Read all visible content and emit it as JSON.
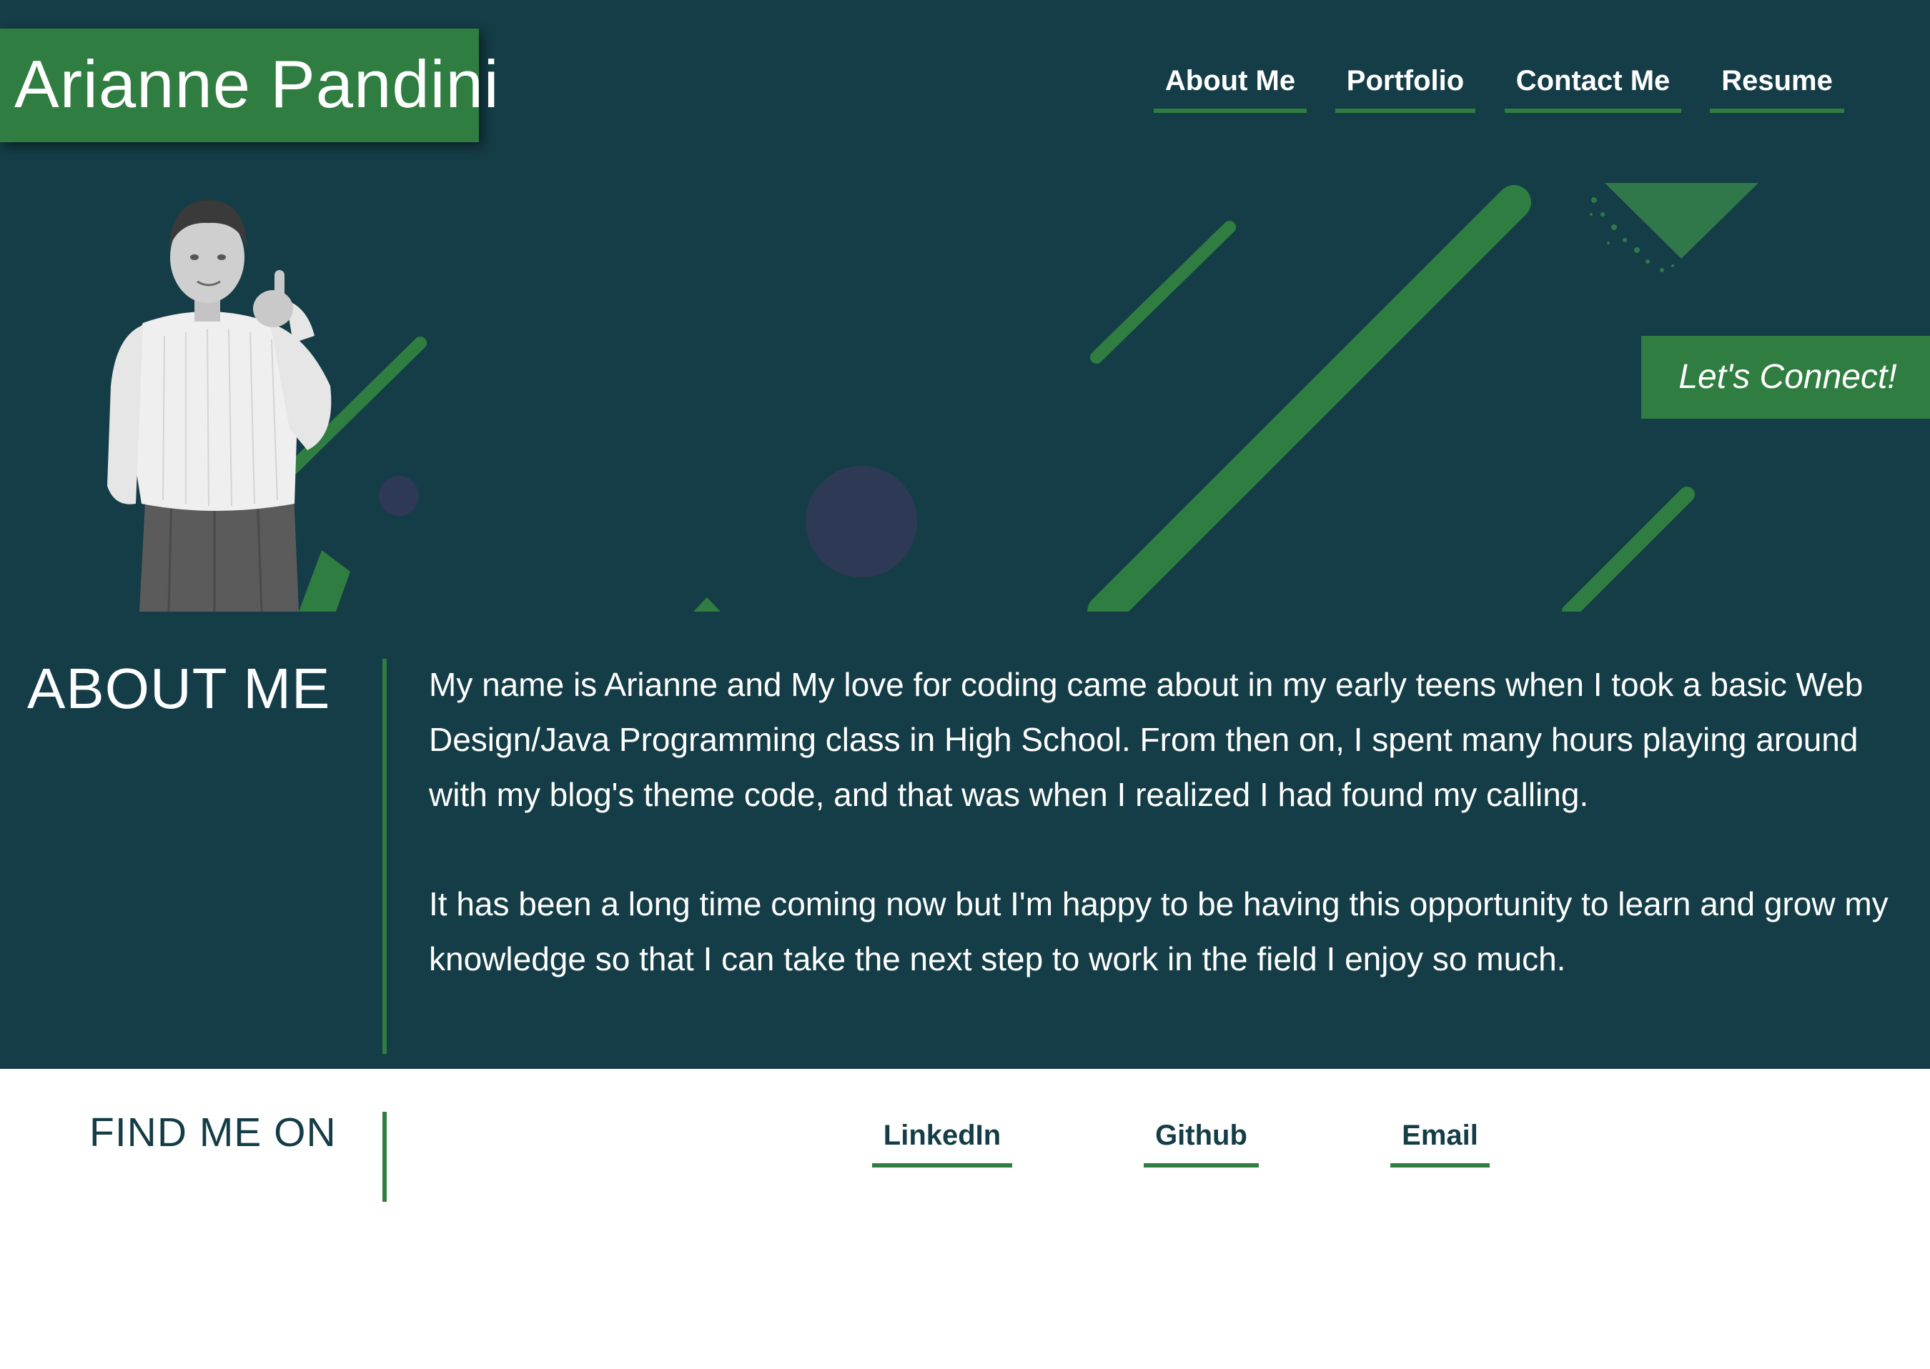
{
  "site": {
    "name": "Arianne Pandini"
  },
  "nav": {
    "items": [
      {
        "label": "About Me"
      },
      {
        "label": "Portfolio"
      },
      {
        "label": "Contact Me"
      },
      {
        "label": "Resume"
      }
    ]
  },
  "hero": {
    "cta_label": "Let's Connect!"
  },
  "about": {
    "title": "ABOUT ME",
    "paragraphs": [
      "My name is Arianne and My love for coding came about in my early teens when I took a basic Web Design/Java Programming class in High School. From then on, I spent many hours playing around with my blog's theme code, and that was when I realized I had found my calling.",
      "It has been a long time coming now but I'm happy to be having this opportunity to learn and grow my knowledge so that I can take the next step to work in the field I enjoy so much."
    ]
  },
  "find_me": {
    "title": "FIND ME ON",
    "links": [
      {
        "label": "LinkedIn"
      },
      {
        "label": "Github"
      },
      {
        "label": "Email"
      }
    ]
  },
  "colors": {
    "background_dark": "#143d47",
    "accent_green": "#2f7d40",
    "text_light": "#ffffff",
    "text_dark": "#143d47",
    "decor_purple": "#2e3a55"
  }
}
